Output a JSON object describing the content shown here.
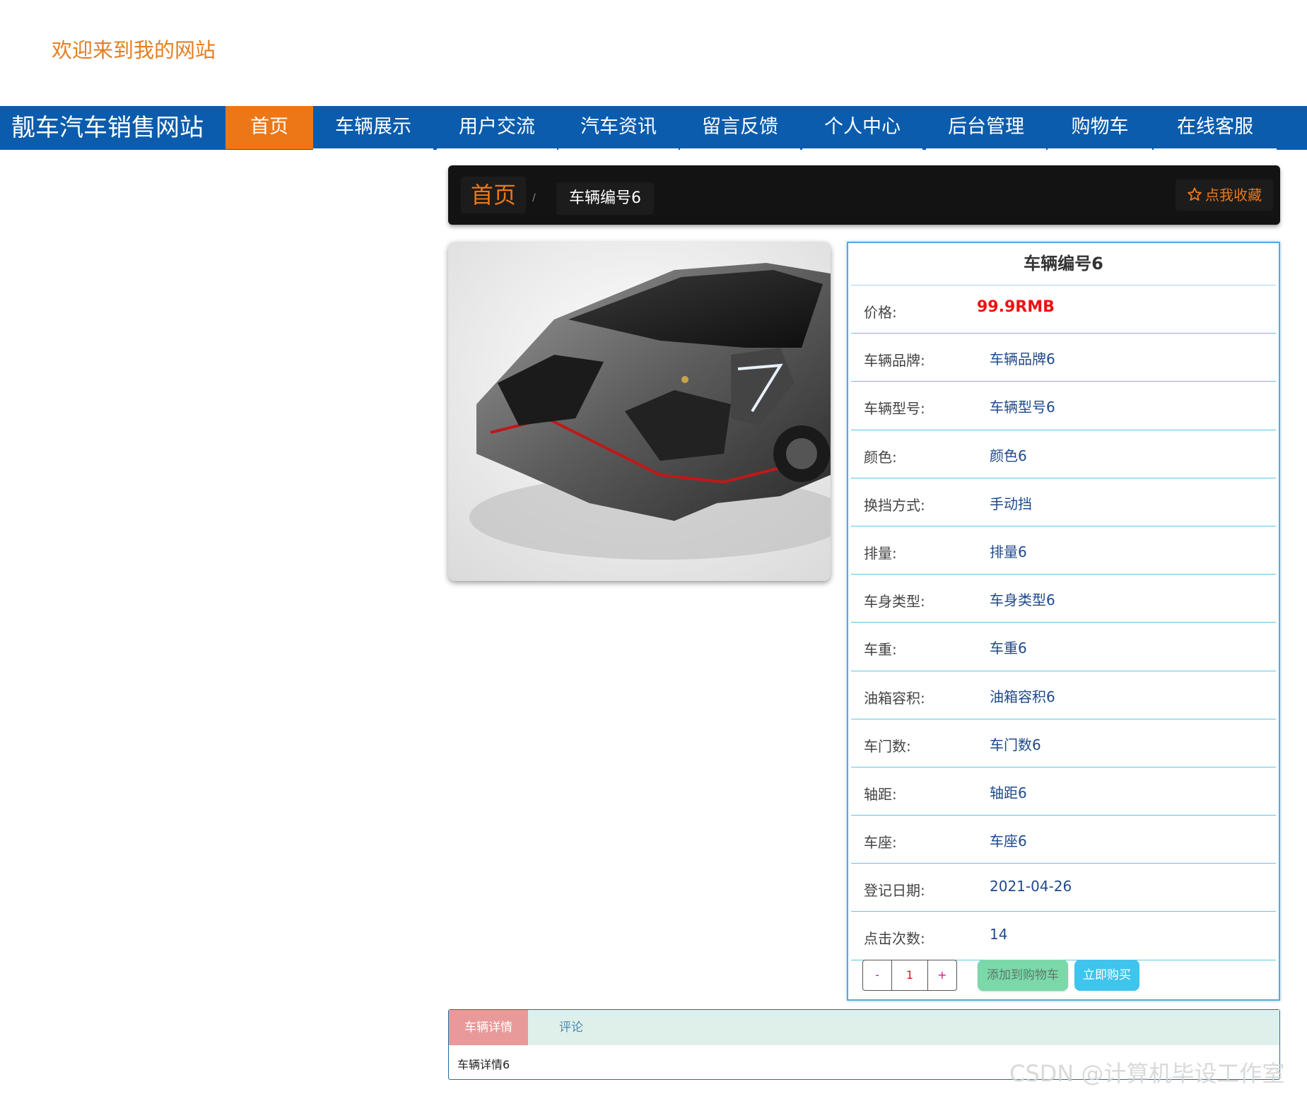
{
  "welcome": "欢迎来到我的网站",
  "nav": {
    "brand": "靓车汽车销售网站",
    "items": [
      {
        "label": "首页",
        "active": true
      },
      {
        "label": "车辆展示"
      },
      {
        "label": "用户交流"
      },
      {
        "label": "汽车资讯"
      },
      {
        "label": "留言反馈"
      },
      {
        "label": "个人中心"
      },
      {
        "label": "后台管理"
      },
      {
        "label": "购物车"
      },
      {
        "label": "在线客服"
      }
    ]
  },
  "breadcrumb": {
    "home": "首页",
    "separator": "/",
    "current": "车辆编号6",
    "favorite": "点我收藏",
    "favorite_icon": "star-outline-icon"
  },
  "car": {
    "title": "车辆编号6",
    "image": "silver-supercar-photo",
    "rows": [
      {
        "label": "价格:",
        "value": "99.9RMB"
      },
      {
        "label": "车辆品牌:",
        "value": "车辆品牌6"
      },
      {
        "label": "车辆型号:",
        "value": "车辆型号6"
      },
      {
        "label": "颜色:",
        "value": "颜色6"
      },
      {
        "label": "换挡方式:",
        "value": "手动挡"
      },
      {
        "label": "排量:",
        "value": "排量6"
      },
      {
        "label": "车身类型:",
        "value": "车身类型6"
      },
      {
        "label": "车重:",
        "value": "车重6"
      },
      {
        "label": "油箱容积:",
        "value": "油箱容积6"
      },
      {
        "label": "车门数:",
        "value": "车门数6"
      },
      {
        "label": "轴距:",
        "value": "轴距6"
      },
      {
        "label": "车座:",
        "value": "车座6"
      },
      {
        "label": "登记日期:",
        "value": "2021-04-26"
      },
      {
        "label": "点击次数:",
        "value": "14"
      }
    ]
  },
  "actions": {
    "minus": "-",
    "quantity": "1",
    "plus": "+",
    "add_to_cart": "添加到购物车",
    "buy_now": "立即购买"
  },
  "tabs": {
    "items": [
      "车辆详情",
      "评论"
    ],
    "content": "车辆详情6"
  },
  "watermark": "CSDN @计算机毕设工作室",
  "colors": {
    "nav_bg": "#0b5cad",
    "accent": "#ed7716",
    "price": "#ee1111"
  }
}
